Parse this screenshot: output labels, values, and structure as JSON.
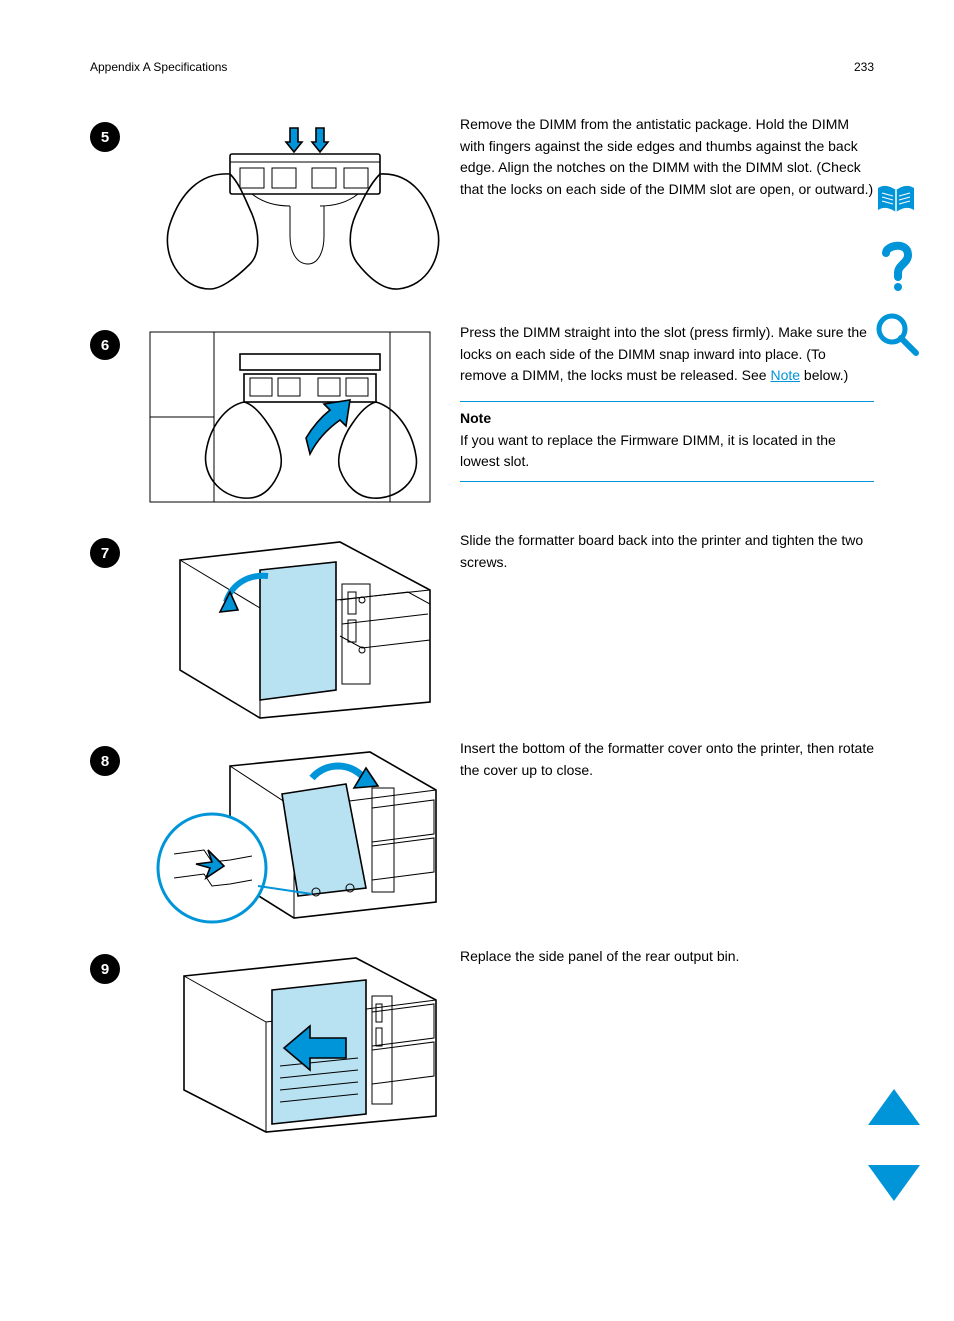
{
  "header": {
    "left": "Appendix A Specifications",
    "right": "233"
  },
  "steps": [
    {
      "num": "5",
      "text": "Remove the DIMM from the antistatic package. Hold the DIMM with fingers against the side edges and thumbs against the back edge. Align the notches on the DIMM with the DIMM slot. (Check that the locks on each side of the DIMM slot are open, or outward.)"
    },
    {
      "num": "6",
      "text_parts": [
        "Press the DIMM straight into the slot (press firmly). Make sure the locks on each side of the DIMM snap inward into place. (To remove a DIMM, the locks must be released. See ",
        {
          "link": "Note",
          "href": "#"
        },
        " below.)"
      ],
      "note": {
        "head": "Note",
        "body": "If you want to replace the Firmware DIMM, it is located in the lowest slot."
      }
    },
    {
      "num": "7",
      "text": "Slide the formatter board back into the printer and tighten the two screws."
    },
    {
      "num": "8",
      "text": "Insert the bottom of the formatter cover onto the printer, then rotate the cover up to close."
    },
    {
      "num": "9",
      "text": "Replace the side panel of the rear output bin."
    }
  ],
  "sidebar": {
    "book": "contents-icon",
    "help": "help-icon",
    "search": "search-icon"
  },
  "nav": {
    "prev": "previous-page",
    "next": "next-page"
  }
}
